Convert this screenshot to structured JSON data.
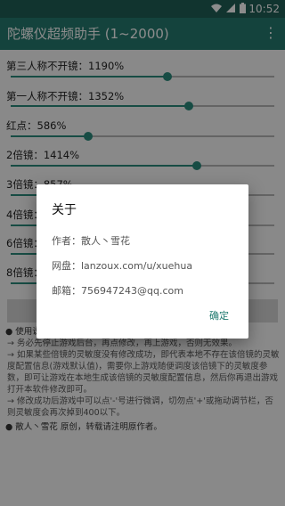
{
  "status_bar": {
    "time": "10:52"
  },
  "app_bar": {
    "title": "陀螺仪超频助手 (1~2000)",
    "overflow_icon": "⋮"
  },
  "settings": [
    {
      "label": "第三人称不开镜：1190%",
      "level_percent": 59.5
    },
    {
      "label": "第一人称不开镜：1352%",
      "level_percent": 67.6
    },
    {
      "label": "红点：586%",
      "level_percent": 29.3
    },
    {
      "label": "2倍镜：1414%",
      "level_percent": 70.7
    },
    {
      "label": "3倍镜：857%",
      "level_percent": 42.9
    },
    {
      "label": "4倍镜：",
      "level_percent": 40
    },
    {
      "label": "6倍镜：",
      "level_percent": 40
    },
    {
      "label": "8倍镜：",
      "level_percent": 40
    }
  ],
  "notes": [
    "● 使用说明：",
    "→ 务必先停止游戏后台，再点修改，再上游戏，否则无效果。",
    "→ 如果某些倍镜的灵敏度没有修改成功，即代表本地不存在该倍镜的灵敏度配置信息(游戏默认值)，需要你上游戏随便调度该倍镜下的灵敏度参数，即可让游戏在本地生成该倍镜的灵敏度配置信息，然后你再退出游戏打开本软件修改即可。",
    "→ 修改成功后游戏中可以点'-'号进行微调，切勿点'+'或拖动调节栏，否则灵敏度会再次掉到400以下。",
    "● 散人丶雪花 原创，转载请注明原作者。"
  ],
  "dialog": {
    "title": "关于",
    "author": "作者：散人丶雪花",
    "netdisk": "网盘：lanzoux.com/u/xuehua",
    "email": "邮箱：756947243@qq.com",
    "ok_label": "确定"
  },
  "colors": {
    "status_bar": "#1f5f57",
    "app_bar": "#267a6f",
    "accent": "#2a8a7d"
  }
}
